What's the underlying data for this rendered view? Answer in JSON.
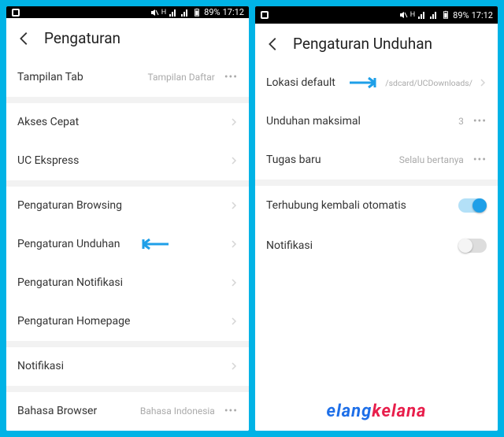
{
  "status": {
    "battery": "89%",
    "time": "17:12",
    "net_label": "H"
  },
  "left": {
    "title": "Pengaturan",
    "rows": [
      {
        "label": "Tampilan Tab",
        "value": "Tampilan Daftar",
        "type": "dots"
      },
      {
        "gap": true
      },
      {
        "label": "Akses Cepat",
        "type": "chevron"
      },
      {
        "label": "UC Ekspress",
        "type": "chevron"
      },
      {
        "gap": true
      },
      {
        "label": "Pengaturan Browsing",
        "type": "chevron"
      },
      {
        "label": "Pengaturan Unduhan",
        "type": "chevron",
        "annotated": true
      },
      {
        "label": "Pengaturan Notifikasi",
        "type": "chevron"
      },
      {
        "label": "Pengaturan Homepage",
        "type": "chevron"
      },
      {
        "gap": true
      },
      {
        "label": "Notifikasi",
        "type": "chevron"
      },
      {
        "gap": true
      },
      {
        "label": "Bahasa Browser",
        "value": "Bahasa Indonesia",
        "type": "dots"
      }
    ]
  },
  "right": {
    "title": "Pengaturan Unduhan",
    "rows": [
      {
        "label": "Lokasi default",
        "value": "/sdcard/UCDownloads/",
        "type": "chevron",
        "annotated": true,
        "small": true
      },
      {
        "label": "Unduhan maksimal",
        "value": "3",
        "type": "dots"
      },
      {
        "label": "Tugas baru",
        "value": "Selalu bertanya",
        "type": "dots"
      },
      {
        "gap": true
      },
      {
        "label": "Terhubung kembali otomatis",
        "type": "toggle",
        "on": true
      },
      {
        "label": "Notifikasi",
        "type": "toggle",
        "on": false
      }
    ]
  },
  "brand": {
    "part1": "elang",
    "part2": "kelana"
  }
}
